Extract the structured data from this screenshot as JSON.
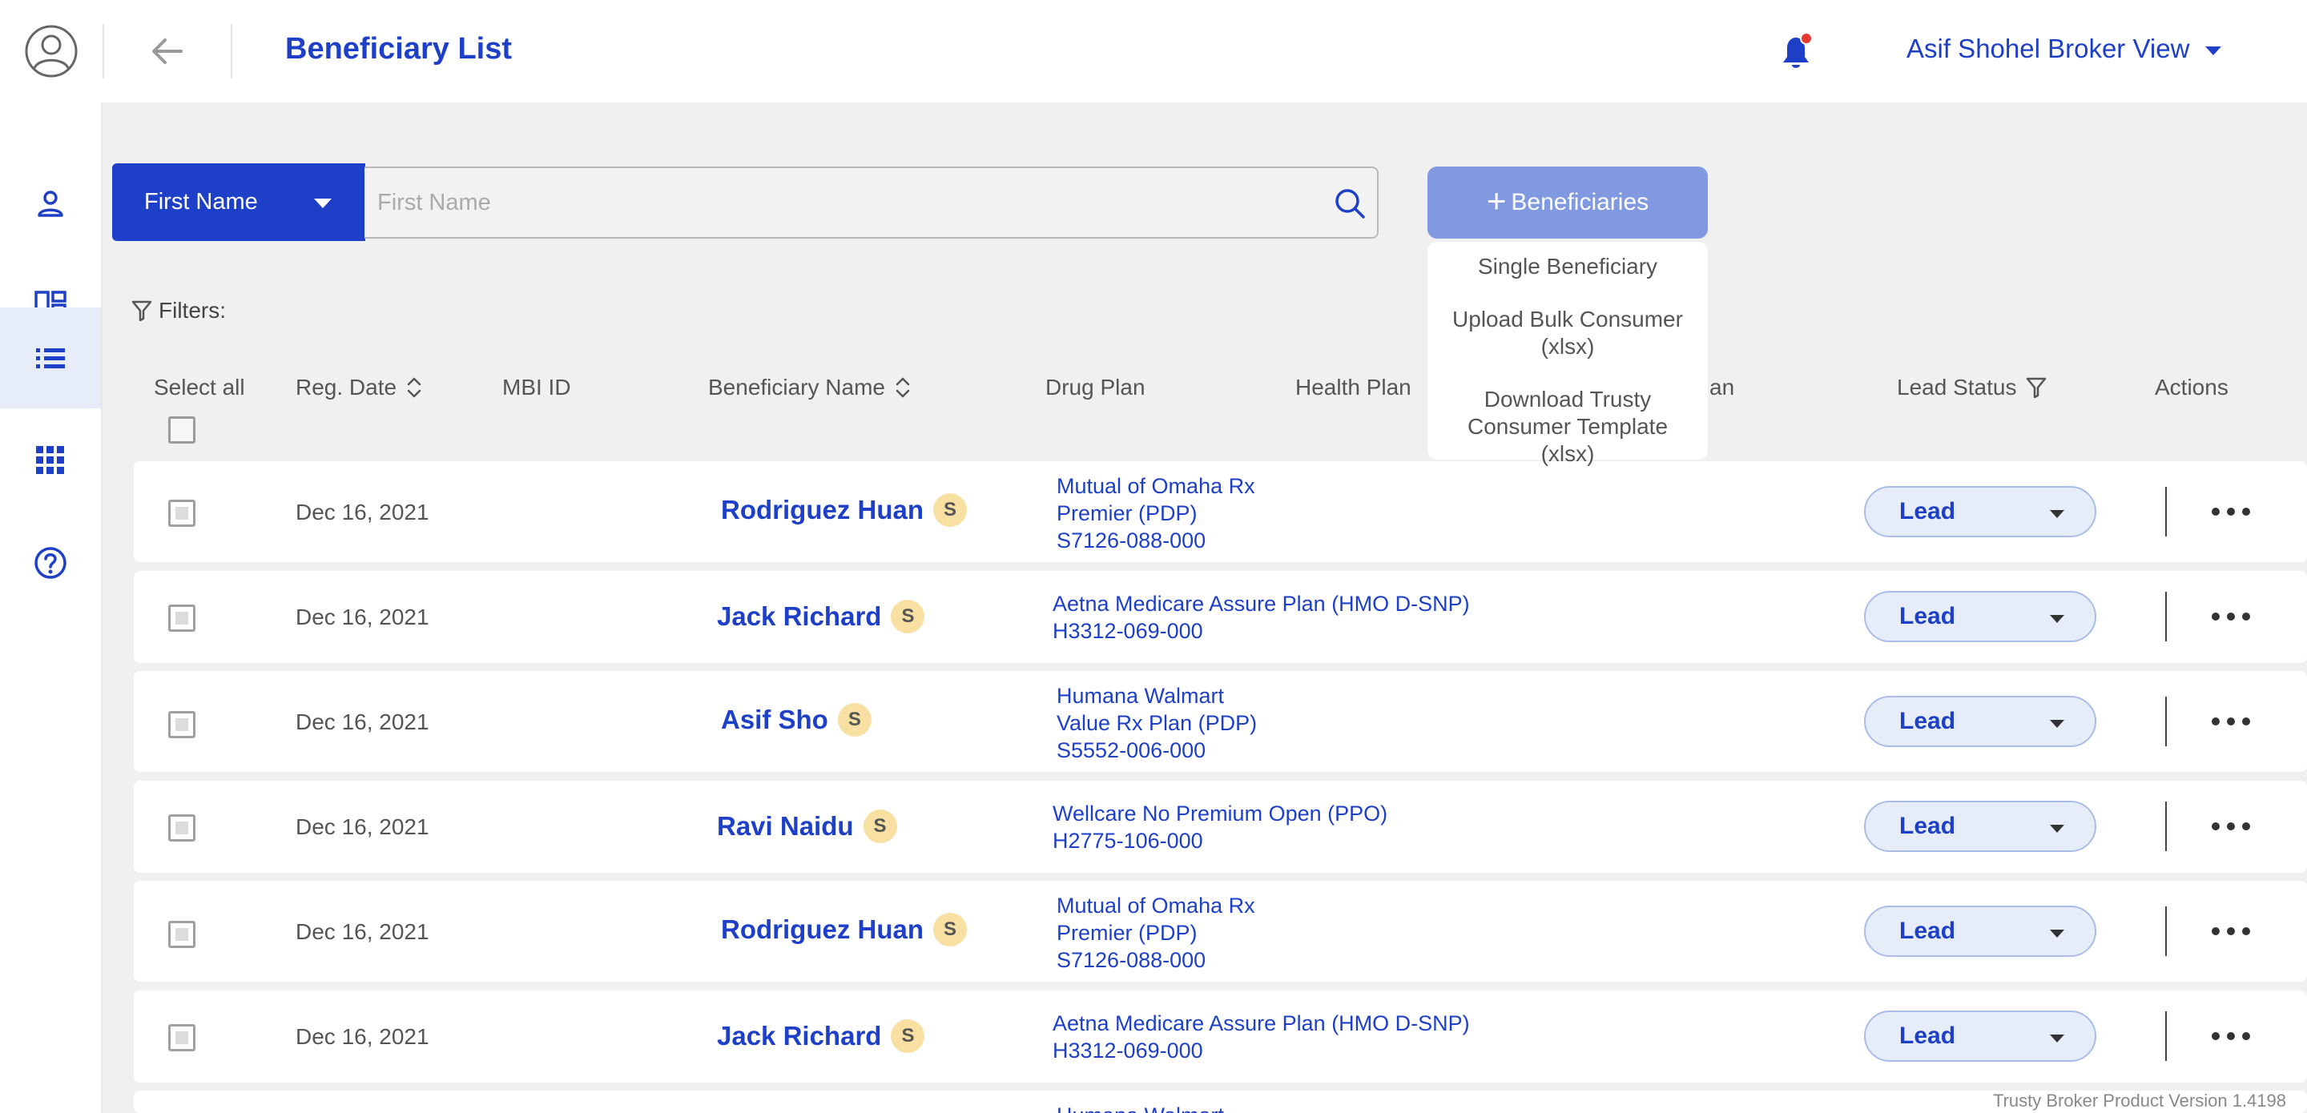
{
  "header": {
    "title": "Beneficiary List",
    "user_name": "Asif Shohel Broker View",
    "brand_color": "#1e40c8",
    "notification_dot_color": "#e53935"
  },
  "sidebar": {
    "items": [
      {
        "icon": "person-icon",
        "active": false
      },
      {
        "icon": "dashboard-icon",
        "active": false
      },
      {
        "icon": "list-icon",
        "active": true
      },
      {
        "icon": "apps-grid-icon",
        "active": false
      },
      {
        "icon": "help-icon",
        "active": false
      }
    ]
  },
  "search": {
    "field_selected": "First Name",
    "placeholder": "First Name",
    "value": ""
  },
  "add_button": {
    "label": "Beneficiaries",
    "menu": [
      "Single Beneficiary",
      "Upload Bulk Consumer (xlsx)",
      "Download Trusty Consumer Template (xlsx)"
    ]
  },
  "filters_label": "Filters:",
  "table": {
    "columns": {
      "select_all": "Select all",
      "reg_date": "Reg. Date",
      "mbi_id": "MBI ID",
      "beneficiary_name": "Beneficiary Name",
      "drug_plan": "Drug Plan",
      "health_plan": "Health Plan",
      "other_plan_fragment": "an",
      "lead_status": "Lead Status",
      "actions": "Actions"
    },
    "rows": [
      {
        "date": "Dec 16, 2021",
        "name": "Rodriguez Huan",
        "badge": "S",
        "plan_lines": [
          "Mutual of Omaha Rx",
          "Premier (PDP)",
          "S7126-088-000"
        ],
        "status": "Lead"
      },
      {
        "date": "Dec 16, 2021",
        "name": "Jack Richard",
        "badge": "S",
        "plan_lines": [
          "Aetna Medicare Assure Plan (HMO D-SNP)",
          "H3312-069-000"
        ],
        "status": "Lead"
      },
      {
        "date": "Dec 16, 2021",
        "name": "Asif Sho",
        "badge": "S",
        "plan_lines": [
          "Humana Walmart",
          "Value Rx Plan (PDP)",
          "S5552-006-000"
        ],
        "status": "Lead"
      },
      {
        "date": "Dec 16, 2021",
        "name": "Ravi Naidu",
        "badge": "S",
        "plan_lines": [
          "Wellcare No Premium Open (PPO)",
          "H2775-106-000"
        ],
        "status": "Lead"
      },
      {
        "date": "Dec 16, 2021",
        "name": "Rodriguez Huan",
        "badge": "S",
        "plan_lines": [
          "Mutual of Omaha Rx",
          "Premier (PDP)",
          "S7126-088-000"
        ],
        "status": "Lead"
      },
      {
        "date": "Dec 16, 2021",
        "name": "Jack Richard",
        "badge": "S",
        "plan_lines": [
          "Aetna Medicare Assure Plan (HMO D-SNP)",
          "H3312-069-000"
        ],
        "status": "Lead"
      },
      {
        "date": "",
        "name": "",
        "badge": "",
        "plan_lines": [
          "Humana Walmart"
        ],
        "status": ""
      }
    ]
  },
  "footer": {
    "version": "Trusty Broker Product Version 1.4198"
  }
}
